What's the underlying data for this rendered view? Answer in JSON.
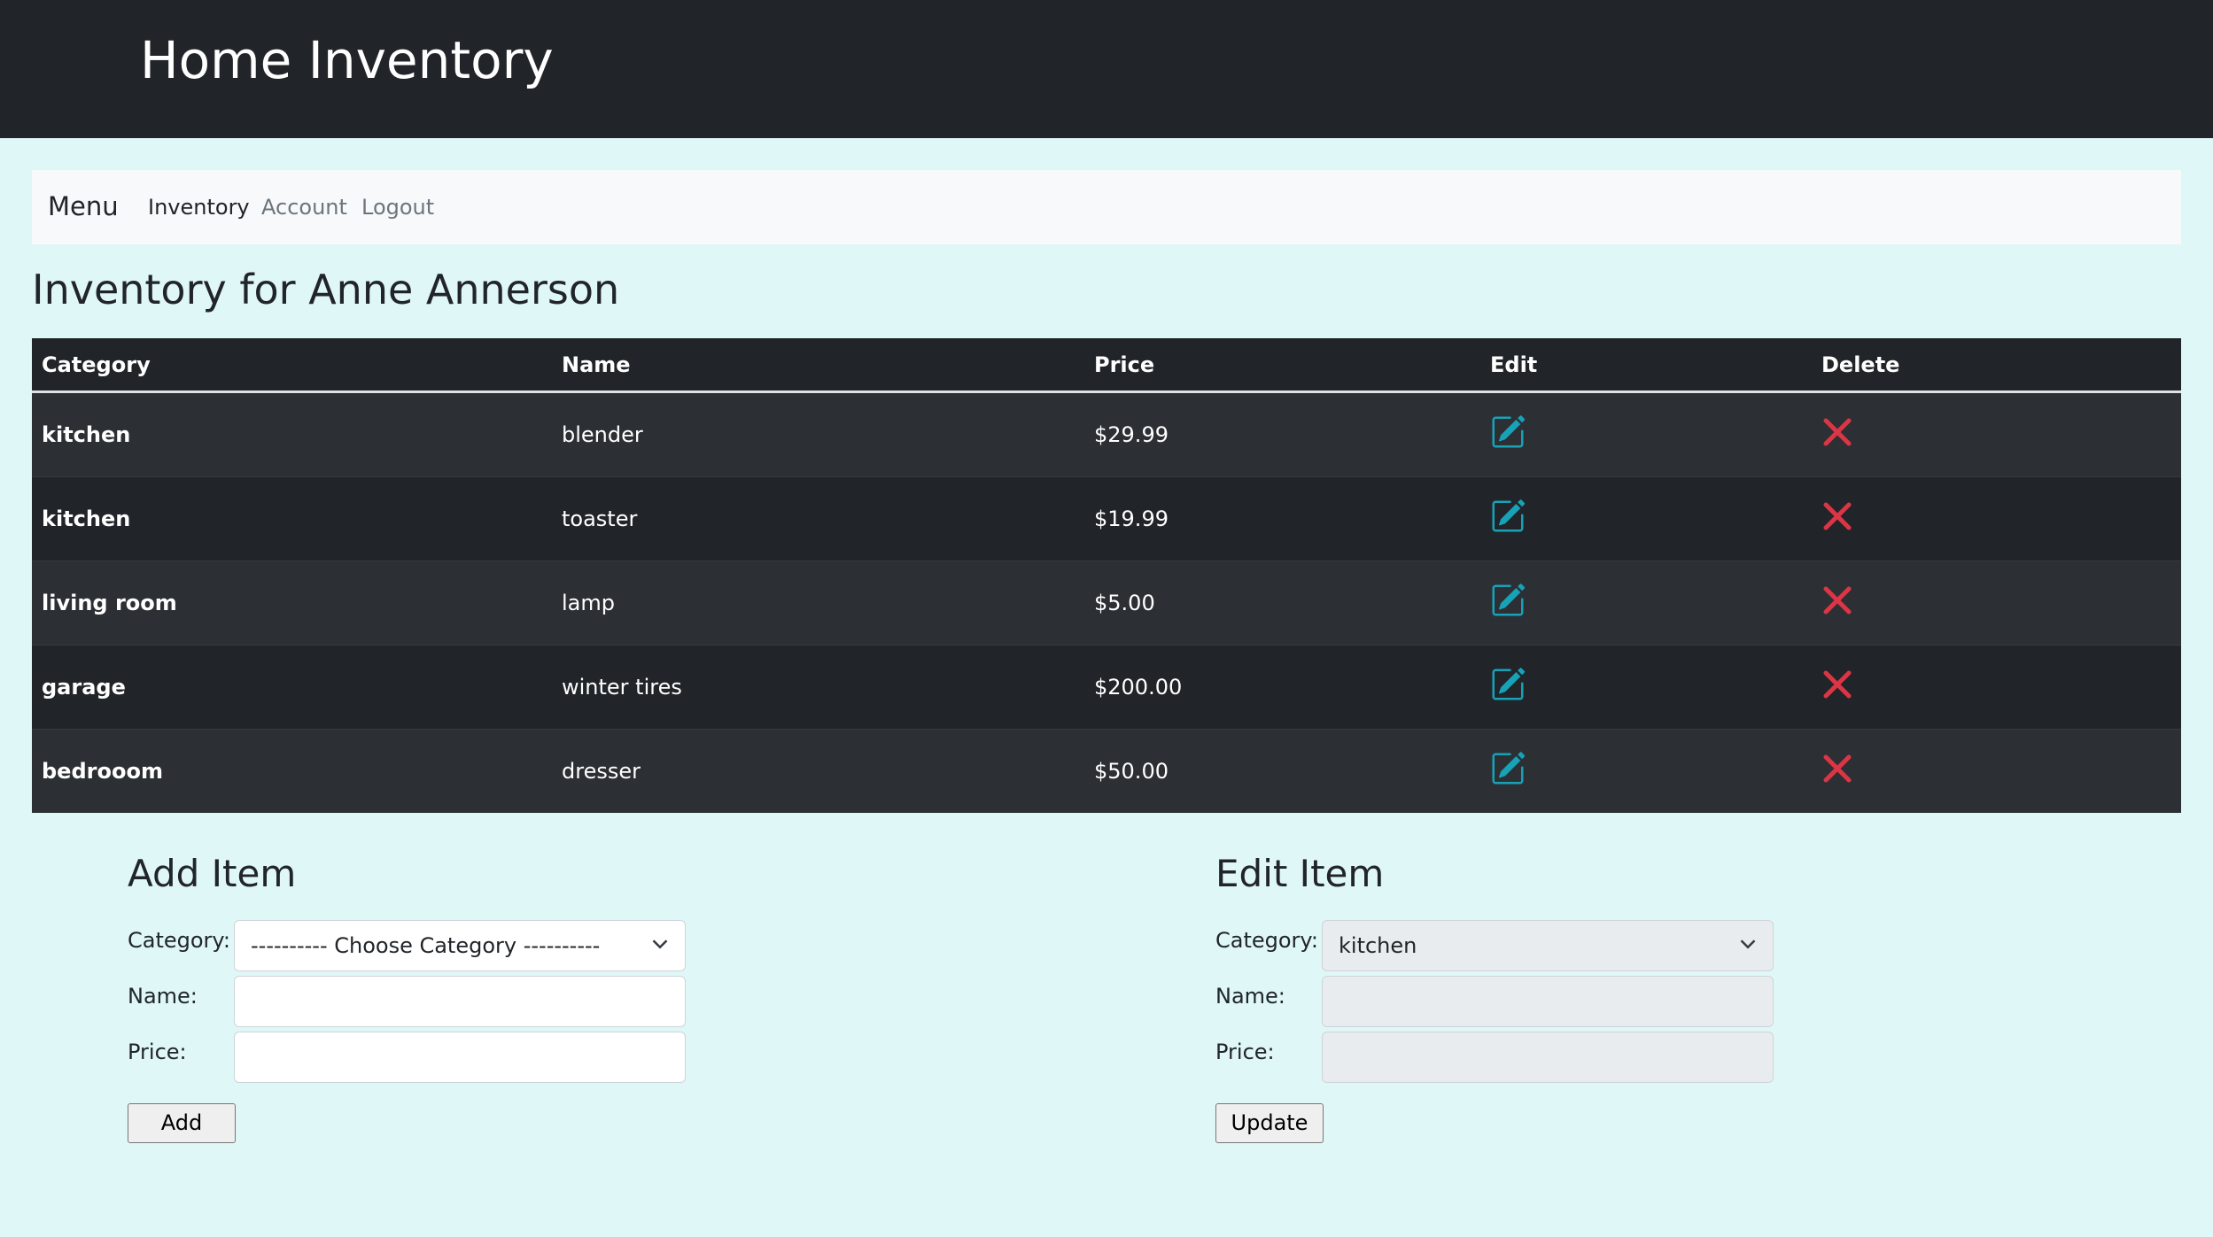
{
  "header": {
    "title": "Home Inventory"
  },
  "menu": {
    "brand": "Menu",
    "items": [
      "Inventory",
      "Account",
      "Logout"
    ]
  },
  "page_title": "Inventory for Anne Annerson",
  "table": {
    "columns": [
      "Category",
      "Name",
      "Price",
      "Edit",
      "Delete"
    ],
    "rows": [
      {
        "category": "kitchen",
        "name": "blender",
        "price": "$29.99"
      },
      {
        "category": "kitchen",
        "name": "toaster",
        "price": "$19.99"
      },
      {
        "category": "living room",
        "name": "lamp",
        "price": "$5.00"
      },
      {
        "category": "garage",
        "name": "winter tires",
        "price": "$200.00"
      },
      {
        "category": "bedrooom",
        "name": "dresser",
        "price": "$50.00"
      }
    ]
  },
  "add_form": {
    "title": "Add Item",
    "category_label": "Category:",
    "category_value": "---------- Choose Category ----------",
    "name_label": "Name:",
    "name_value": "",
    "price_label": "Price:",
    "price_value": "",
    "button": "Add"
  },
  "edit_form": {
    "title": "Edit Item",
    "category_label": "Category:",
    "category_value": "kitchen",
    "name_label": "Name:",
    "name_value": "",
    "price_label": "Price:",
    "price_value": "",
    "button": "Update"
  },
  "colors": {
    "edit_icon": "#17a2b8",
    "delete_icon": "#dc3545",
    "header_bg": "#212529",
    "page_bg": "#dff7f7"
  },
  "icons": {
    "edit": "pencil-square-icon",
    "delete": "x-icon",
    "select": "chevron-down-icon"
  }
}
